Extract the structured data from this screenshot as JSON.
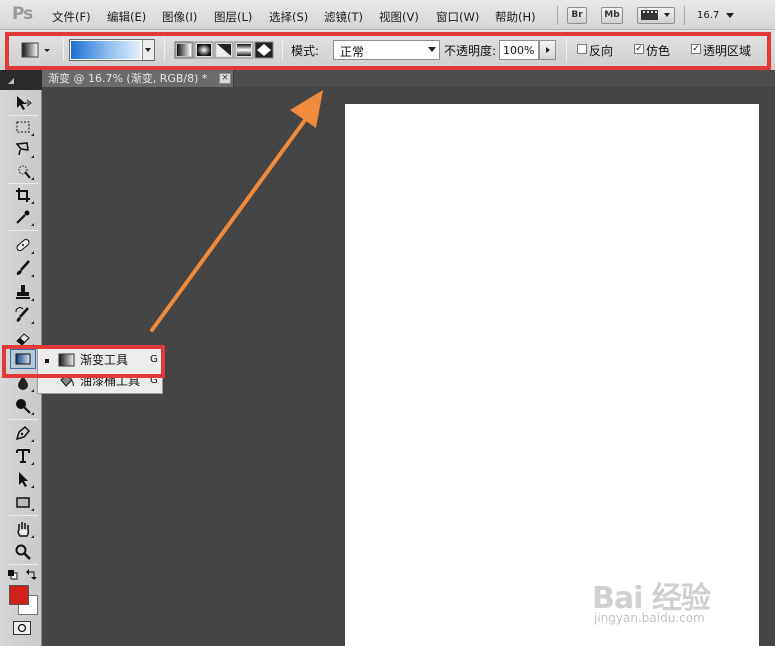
{
  "app": {
    "logo": "Ps"
  },
  "menubar": {
    "items": [
      "文件(F)",
      "编辑(E)",
      "图像(I)",
      "图层(L)",
      "选择(S)",
      "滤镜(T)",
      "视图(V)",
      "窗口(W)",
      "帮助(H)"
    ],
    "bridge_label": "Br",
    "minibridge_label": "Mb",
    "zoom_label": "16.7"
  },
  "options": {
    "mode_label": "模式:",
    "mode_value": "正常",
    "opacity_label": "不透明度:",
    "opacity_value": "100%",
    "reverse_label": "反向",
    "reverse_checked": false,
    "dither_label": "仿色",
    "dither_checked": true,
    "transparency_label": "透明区域",
    "transparency_checked": true
  },
  "document": {
    "tab_title": "渐变 @ 16.7% (渐变, RGB/8) *",
    "close_label": "×"
  },
  "flyout": {
    "items": [
      {
        "label": "渐变工具",
        "shortcut": "G",
        "active": true
      },
      {
        "label": "油漆桶工具",
        "shortcut": "G",
        "active": false
      }
    ]
  },
  "colors": {
    "foreground": "#d0211d",
    "background": "#ffffff",
    "highlight": "#e23a3a",
    "arrow": "#f08a3c"
  },
  "watermark": {
    "text": "Bai 经验",
    "sub": "jingyan.baidu.com"
  }
}
